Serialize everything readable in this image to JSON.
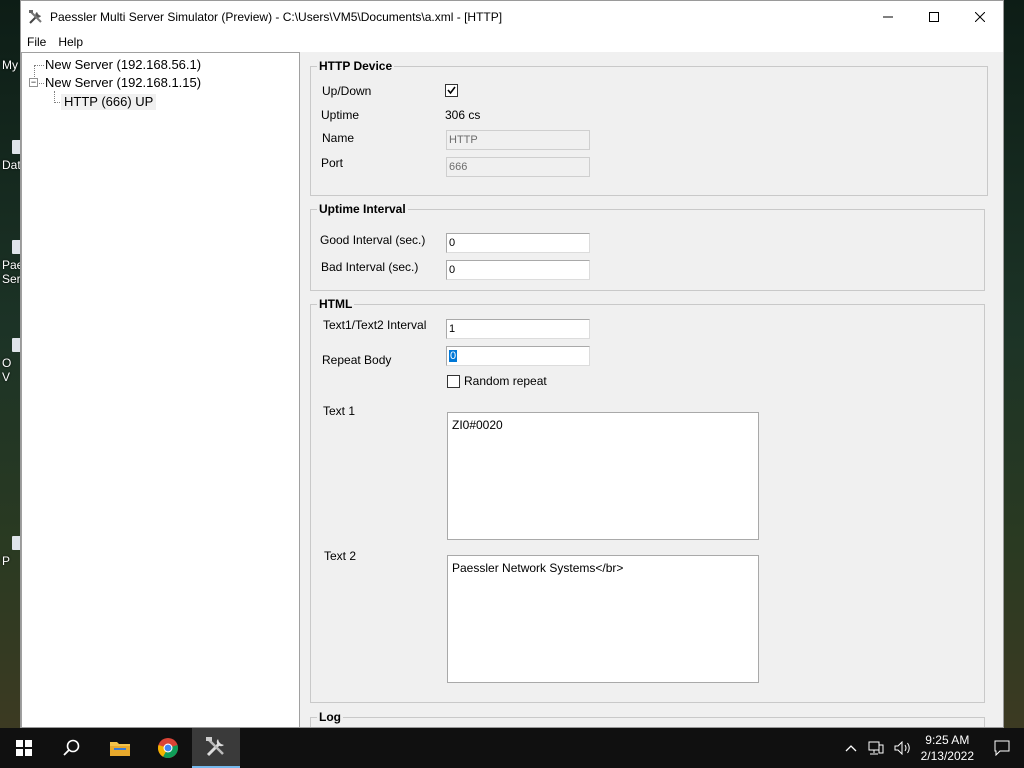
{
  "desktop": {
    "labels": [
      "My",
      "Dat",
      "Pae",
      "Ser",
      "O",
      "V",
      "P"
    ]
  },
  "window": {
    "title": "Paessler Multi Server Simulator (Preview) - C:\\Users\\VM5\\Documents\\a.xml - [HTTP]"
  },
  "menu": {
    "file": "File",
    "help": "Help"
  },
  "tree": {
    "nodes": [
      {
        "label": "New Server (192.168.56.1)"
      },
      {
        "label": "New Server (192.168.1.15)"
      },
      {
        "label": "HTTP (666)  UP"
      }
    ]
  },
  "http_device": {
    "legend": "HTTP Device",
    "updown_label": "Up/Down",
    "updown_checked": true,
    "uptime_label": "Uptime",
    "uptime_value": "306 cs",
    "name_label": "Name",
    "name_value": "HTTP",
    "port_label": "Port",
    "port_value": "666"
  },
  "uptime_interval": {
    "legend": "Uptime Interval",
    "good_label": "Good Interval (sec.)",
    "good_value": "0",
    "bad_label": "Bad Interval (sec.)",
    "bad_value": "0"
  },
  "html": {
    "legend": "HTML",
    "text_interval_label": "Text1/Text2 Interval",
    "text_interval_value": "1",
    "repeat_body_label": "Repeat Body",
    "repeat_body_value": "0",
    "random_repeat_label": "Random repeat",
    "random_repeat_checked": false,
    "text1_label": "Text 1",
    "text1_value": "ZI0#0020",
    "text2_label": "Text 2",
    "text2_value": "Paessler Network Systems</br>"
  },
  "log": {
    "legend": "Log"
  },
  "taskbar": {
    "time": "9:25 AM",
    "date": "2/13/2022"
  }
}
